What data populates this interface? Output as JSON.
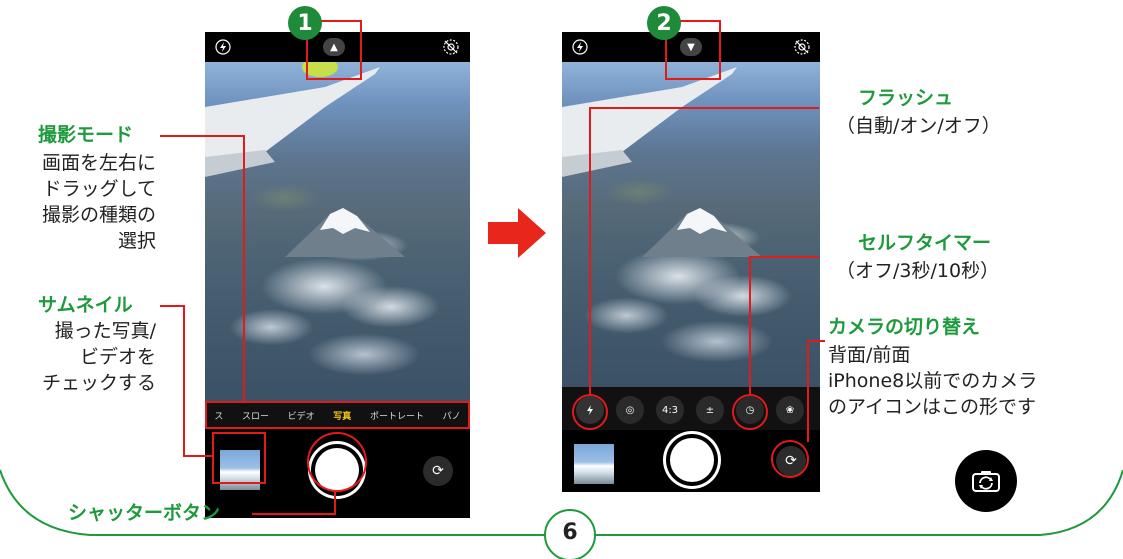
{
  "steps": {
    "one": "1",
    "two": "2"
  },
  "labels": {
    "shooting_mode_title": "撮影モード",
    "shooting_mode_desc": [
      "画面を左右に",
      "ドラッグして",
      "撮影の種類の",
      "選択"
    ],
    "thumbnail_title": "サムネイル",
    "thumbnail_desc": [
      "撮った写真/",
      "ビデオを",
      "チェックする"
    ],
    "shutter_title": "シャッターボタン",
    "flash_title": "フラッシュ",
    "flash_desc": "（自動/オン/オフ）",
    "self_timer_title": "セルフタイマー",
    "self_timer_desc": "（オフ/3秒/10秒）",
    "camera_switch_title": "カメラの切り替え",
    "camera_switch_desc": [
      "背面/前面",
      "iPhone8以前でのカメラ",
      "のアイコンはこの形です"
    ]
  },
  "phone1": {
    "modes": [
      "ス",
      "スロー",
      "ビデオ",
      "写真",
      "ポートレート",
      "パノ"
    ],
    "selected_mode": "写真"
  },
  "phone2": {
    "aspect_label": "4:3"
  },
  "page_number": "6",
  "colors": {
    "accent_green": "#1e9a3c",
    "highlight_red": "#e31a1a",
    "arrow_red": "#e8261c"
  },
  "icons": {
    "flash": "flash-icon",
    "live_photo": "live-photo-off-icon",
    "chevron_up": "chevron-up-icon",
    "chevron_down": "chevron-down-icon",
    "exposure": "exposure-icon",
    "timer": "timer-icon",
    "filter": "filter-icon",
    "switch_camera": "switch-camera-icon"
  }
}
